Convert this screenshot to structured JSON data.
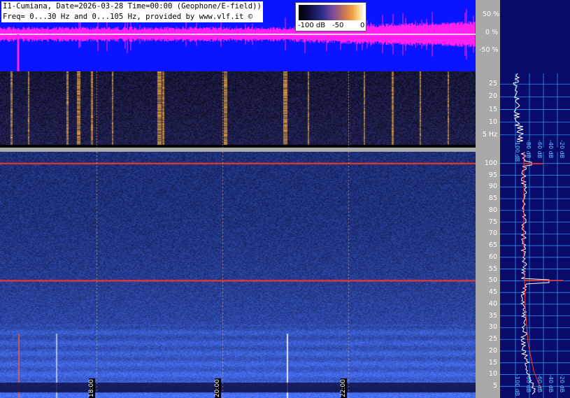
{
  "header": {
    "title_line1": "I1-Cumiana, Date=2026-03-28 Time=00:00 (Geophone/E-field))",
    "title_line2": "Freq= 0...30 Hz and 0...105 Hz, provided by www.vlf.it ©"
  },
  "colorbar": {
    "labels": [
      "-100 dB",
      "-50",
      "0"
    ]
  },
  "amplitude_scale": {
    "labels": [
      "50 %",
      "0 %",
      "-50 %"
    ]
  },
  "small_freq_scale": {
    "labels": [
      "25",
      "20",
      "15",
      "10",
      "5 Hz"
    ]
  },
  "big_freq_scale": {
    "labels": [
      "100",
      "95",
      "90",
      "85",
      "80",
      "75",
      "70",
      "65",
      "60",
      "55",
      "50",
      "45",
      "40",
      "35",
      "30",
      "25",
      "20",
      "15",
      "10",
      "5"
    ]
  },
  "time_labels": [
    "18:00",
    "20:00",
    "22:00"
  ],
  "spectrum_small_labels": [
    "-100 dB",
    "-80 dB",
    "-60 dB",
    "-40 dB",
    "-20 dB"
  ],
  "spectrum_big_labels": [
    "-100 dB",
    "-80 dB",
    "-60 dB",
    "-40 dB",
    "-20 dB"
  ],
  "colors": {
    "wave_bg": "#0b14ff",
    "waveform": "#ff22ee",
    "spec_bg": "#3a3f8e",
    "hum_line": "#ff3a2a",
    "grid": "#ffcf80",
    "spectrum_bg": "#0a0a6a"
  }
}
